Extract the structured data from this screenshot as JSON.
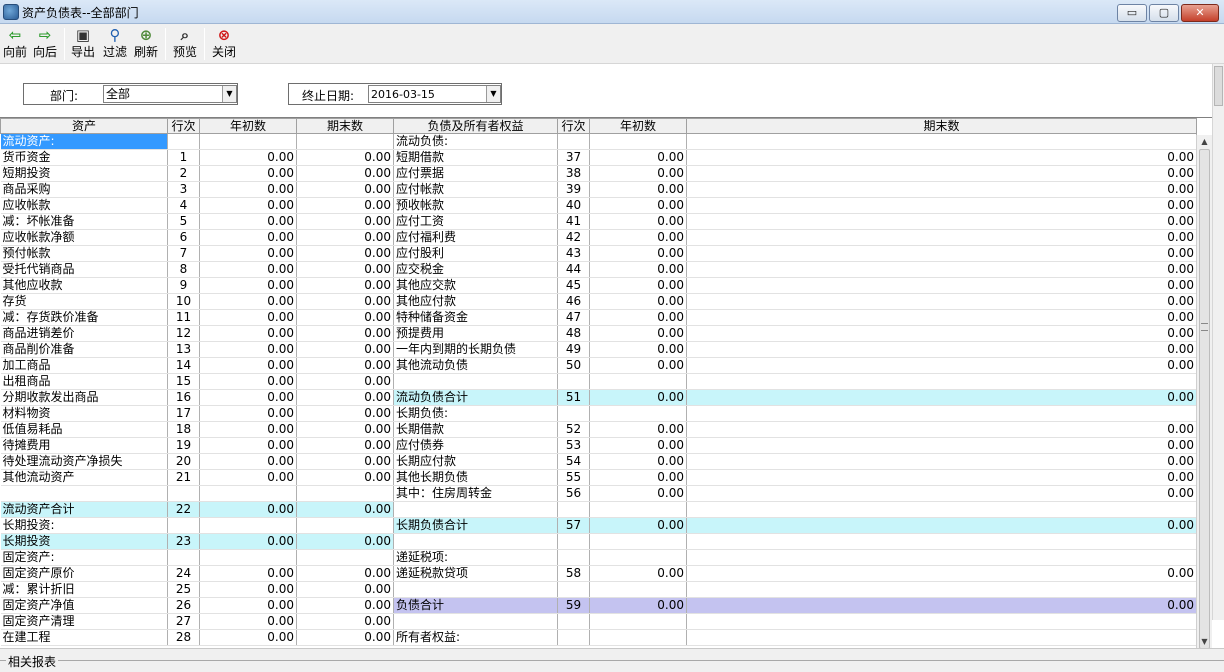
{
  "window": {
    "title": "资产负债表--全部部门",
    "min_glyph": "▭",
    "max_glyph": "▢",
    "close_glyph": "✕"
  },
  "toolbar": [
    {
      "label": "向前",
      "icon": "arrow-left-icon",
      "glyph": "⇦",
      "color": "#2e9b2e"
    },
    {
      "label": "向后",
      "icon": "arrow-right-icon",
      "glyph": "⇨",
      "color": "#2e9b2e"
    },
    {
      "label": "导出",
      "icon": "export-icon",
      "glyph": "▣",
      "color": "#333333"
    },
    {
      "label": "过滤",
      "icon": "filter-search-icon",
      "glyph": "⚲",
      "color": "#1f5fb0"
    },
    {
      "label": "刷新",
      "icon": "refresh-icon",
      "glyph": "⊕",
      "color": "#4f8a3a"
    },
    {
      "label": "预览",
      "icon": "preview-icon",
      "glyph": "⌕",
      "color": "#333333"
    },
    {
      "label": "关闭",
      "icon": "close-circle-icon",
      "glyph": "⊗",
      "color": "#d01818"
    }
  ],
  "filter": {
    "dept_label": "部门:",
    "dept_value": "全部",
    "date_label": "终止日期:",
    "date_value": "2016-03-15",
    "dropdown_glyph": "▼"
  },
  "columns": [
    "资产",
    "行次",
    "年初数",
    "期末数",
    "负债及所有者权益",
    "行次",
    "年初数",
    "期末数"
  ],
  "rows": [
    {
      "a": "流动资产:",
      "an": "",
      "ab": "",
      "ae": "",
      "l": "流动负债:",
      "ln": "",
      "lb": "",
      "le": "",
      "asel": true
    },
    {
      "a": "货币资金",
      "an": "1",
      "ab": "0.00",
      "ae": "0.00",
      "l": "短期借款",
      "ln": "37",
      "lb": "0.00",
      "le": "0.00"
    },
    {
      "a": "短期投资",
      "an": "2",
      "ab": "0.00",
      "ae": "0.00",
      "l": "应付票据",
      "ln": "38",
      "lb": "0.00",
      "le": "0.00"
    },
    {
      "a": "商品采购",
      "an": "3",
      "ab": "0.00",
      "ae": "0.00",
      "l": "应付帐款",
      "ln": "39",
      "lb": "0.00",
      "le": "0.00"
    },
    {
      "a": "应收帐款",
      "an": "4",
      "ab": "0.00",
      "ae": "0.00",
      "l": "预收帐款",
      "ln": "40",
      "lb": "0.00",
      "le": "0.00"
    },
    {
      "a": "减：坏帐准备",
      "an": "5",
      "ab": "0.00",
      "ae": "0.00",
      "l": "应付工资",
      "ln": "41",
      "lb": "0.00",
      "le": "0.00"
    },
    {
      "a": "应收帐款净额",
      "an": "6",
      "ab": "0.00",
      "ae": "0.00",
      "l": "应付福利费",
      "ln": "42",
      "lb": "0.00",
      "le": "0.00"
    },
    {
      "a": "预付帐款",
      "an": "7",
      "ab": "0.00",
      "ae": "0.00",
      "l": "应付股利",
      "ln": "43",
      "lb": "0.00",
      "le": "0.00"
    },
    {
      "a": "受托代销商品",
      "an": "8",
      "ab": "0.00",
      "ae": "0.00",
      "l": " 应交税金",
      "ln": "44",
      "lb": "0.00",
      "le": "0.00"
    },
    {
      "a": "其他应收款",
      "an": "9",
      "ab": "0.00",
      "ae": "0.00",
      "l": "其他应交款",
      "ln": "45",
      "lb": "0.00",
      "le": "0.00"
    },
    {
      "a": "存货",
      "an": "10",
      "ab": "0.00",
      "ae": "0.00",
      "l": "其他应付款",
      "ln": "46",
      "lb": "0.00",
      "le": "0.00"
    },
    {
      "a": "减：存货跌价准备",
      "an": "11",
      "ab": "0.00",
      "ae": "0.00",
      "l": "特种储备资金",
      "ln": "47",
      "lb": "0.00",
      "le": "0.00"
    },
    {
      "a": "商品进销差价",
      "an": "12",
      "ab": "0.00",
      "ae": "0.00",
      "l": "预提费用",
      "ln": "48",
      "lb": "0.00",
      "le": "0.00"
    },
    {
      "a": "商品削价准备",
      "an": "13",
      "ab": "0.00",
      "ae": "0.00",
      "l": "一年内到期的长期负债",
      "ln": "49",
      "lb": "0.00",
      "le": "0.00"
    },
    {
      "a": "加工商品",
      "an": "14",
      "ab": "0.00",
      "ae": "0.00",
      "l": "其他流动负债",
      "ln": "50",
      "lb": "0.00",
      "le": "0.00"
    },
    {
      "a": "出租商品",
      "an": "15",
      "ab": "0.00",
      "ae": "0.00",
      "l": "",
      "ln": "",
      "lb": "",
      "le": ""
    },
    {
      "a": "分期收款发出商品",
      "an": "16",
      "ab": "0.00",
      "ae": "0.00",
      "l": "流动负债合计",
      "ln": "51",
      "lb": "0.00",
      "le": "0.00",
      "lhl": "cyan"
    },
    {
      "a": "材料物资",
      "an": "17",
      "ab": "0.00",
      "ae": "0.00",
      "l": "长期负债:",
      "ln": "",
      "lb": "",
      "le": "",
      "lhead": true
    },
    {
      "a": "低值易耗品",
      "an": "18",
      "ab": "0.00",
      "ae": "0.00",
      "l": "长期借款",
      "ln": "52",
      "lb": "0.00",
      "le": "0.00"
    },
    {
      "a": "待摊费用",
      "an": "19",
      "ab": "0.00",
      "ae": "0.00",
      "l": "应付债券",
      "ln": "53",
      "lb": "0.00",
      "le": "0.00"
    },
    {
      "a": "待处理流动资产净损失",
      "an": "20",
      "ab": "0.00",
      "ae": "0.00",
      "l": "长期应付款",
      "ln": "54",
      "lb": "0.00",
      "le": "0.00"
    },
    {
      "a": "其他流动资产",
      "an": "21",
      "ab": "0.00",
      "ae": "0.00",
      "l": "其他长期负债",
      "ln": "55",
      "lb": "0.00",
      "le": "0.00"
    },
    {
      "a": "",
      "an": "",
      "ab": "",
      "ae": "",
      "l": "其中：住房周转金",
      "ln": "56",
      "lb": "0.00",
      "le": "0.00"
    },
    {
      "a": "流动资产合计",
      "an": "22",
      "ab": "0.00",
      "ae": "0.00",
      "l": "",
      "ln": "",
      "lb": "",
      "le": "",
      "ahl": "cyan"
    },
    {
      "a": "长期投资:",
      "an": "",
      "ab": "",
      "ae": "",
      "l": "长期负债合计",
      "ln": "57",
      "lb": "0.00",
      "le": "0.00",
      "ahead": true,
      "lhl": "cyan"
    },
    {
      "a": "长期投资",
      "an": "23",
      "ab": "0.00",
      "ae": "0.00",
      "l": "",
      "ln": "",
      "lb": "",
      "le": "",
      "ahl": "cyan"
    },
    {
      "a": "固定资产:",
      "an": "",
      "ab": "",
      "ae": "",
      "l": "递延税项:",
      "ln": "",
      "lb": "",
      "le": "",
      "ahead": true,
      "lhead": true
    },
    {
      "a": "固定资产原价",
      "an": "24",
      "ab": "0.00",
      "ae": "0.00",
      "l": "递延税款贷项",
      "ln": "58",
      "lb": "0.00",
      "le": "0.00"
    },
    {
      "a": "减：累计折旧",
      "an": "25",
      "ab": "0.00",
      "ae": "0.00",
      "l": "",
      "ln": "",
      "lb": "",
      "le": ""
    },
    {
      "a": "固定资产净值",
      "an": "26",
      "ab": "0.00",
      "ae": "0.00",
      "l": "负债合计",
      "ln": "59",
      "lb": "0.00",
      "le": "0.00",
      "lhl": "purple"
    },
    {
      "a": "固定资产清理",
      "an": "27",
      "ab": "0.00",
      "ae": "0.00",
      "l": "",
      "ln": "",
      "lb": "",
      "le": ""
    },
    {
      "a": "在建工程",
      "an": "28",
      "ab": "0.00",
      "ae": "0.00",
      "l": "所有者权益:",
      "ln": "",
      "lb": "",
      "le": "",
      "lhead": true
    }
  ],
  "bottom": {
    "related_reports": "相关报表"
  }
}
